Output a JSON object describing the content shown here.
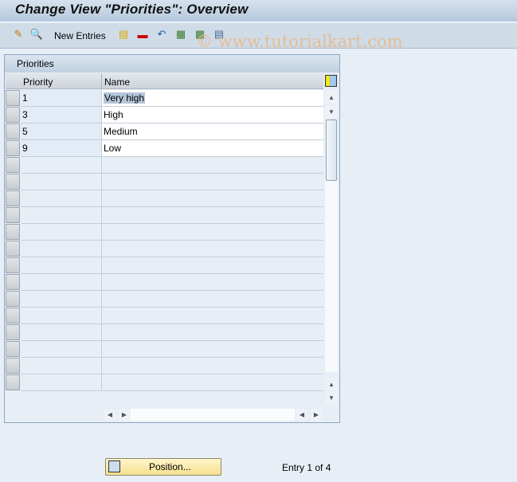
{
  "window": {
    "title": "Change View \"Priorities\": Overview"
  },
  "toolbar": {
    "icons": [
      "display-change-icon",
      "details-icon",
      "copy-icon",
      "delete-icon",
      "undo-icon",
      "select-all-icon",
      "select-block-icon",
      "deselect-all-icon"
    ],
    "new_entries_label": "New Entries"
  },
  "watermark": "© www.tutorialkart.com",
  "table": {
    "title": "Priorities",
    "columns": [
      "Priority",
      "Name"
    ],
    "rows": [
      {
        "priority": "1",
        "name": "Very high"
      },
      {
        "priority": "3",
        "name": "High"
      },
      {
        "priority": "5",
        "name": "Medium"
      },
      {
        "priority": "9",
        "name": "Low"
      }
    ],
    "empty_rows": 14
  },
  "footer": {
    "position_label": "Position...",
    "entry_text": "Entry 1 of 4"
  }
}
